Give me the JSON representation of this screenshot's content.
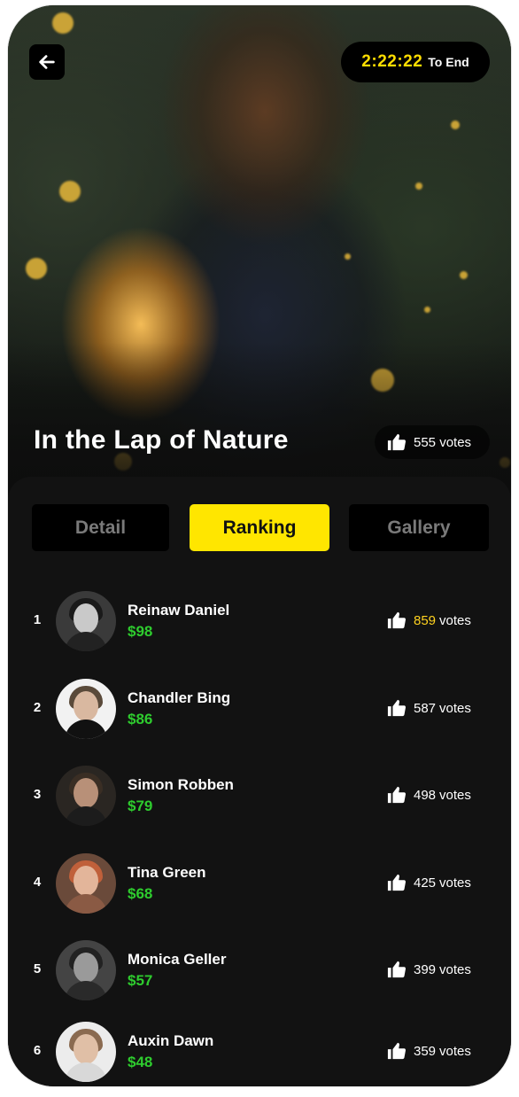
{
  "header": {
    "timer_value": "2:22:22",
    "timer_label": "To End"
  },
  "hero": {
    "title": "In the Lap of Nature",
    "votes_text": "555 votes"
  },
  "tabs": [
    {
      "label": "Detail",
      "active": false
    },
    {
      "label": "Ranking",
      "active": true
    },
    {
      "label": "Gallery",
      "active": false
    }
  ],
  "ranking": [
    {
      "rank": "1",
      "name": "Reinaw Daniel",
      "price": "$98",
      "votes": "859",
      "unit": "votes"
    },
    {
      "rank": "2",
      "name": "Chandler Bing",
      "price": "$86",
      "votes": "587",
      "unit": "votes"
    },
    {
      "rank": "3",
      "name": "Simon Robben",
      "price": "$79",
      "votes": "498",
      "unit": "votes"
    },
    {
      "rank": "4",
      "name": "Tina Green",
      "price": "$68",
      "votes": "425",
      "unit": "votes"
    },
    {
      "rank": "5",
      "name": "Monica Geller",
      "price": "$57",
      "votes": "399",
      "unit": "votes"
    },
    {
      "rank": "6",
      "name": "Auxin Dawn",
      "price": "$48",
      "votes": "359",
      "unit": "votes"
    }
  ],
  "icons": {
    "back": "arrow-left-icon",
    "vote": "thumbs-up-icon"
  },
  "colors": {
    "accent": "#ffe600",
    "timer": "#ffdd00",
    "price": "#2ecc2e",
    "top_votes": "#ffd21f",
    "background": "#121212"
  }
}
